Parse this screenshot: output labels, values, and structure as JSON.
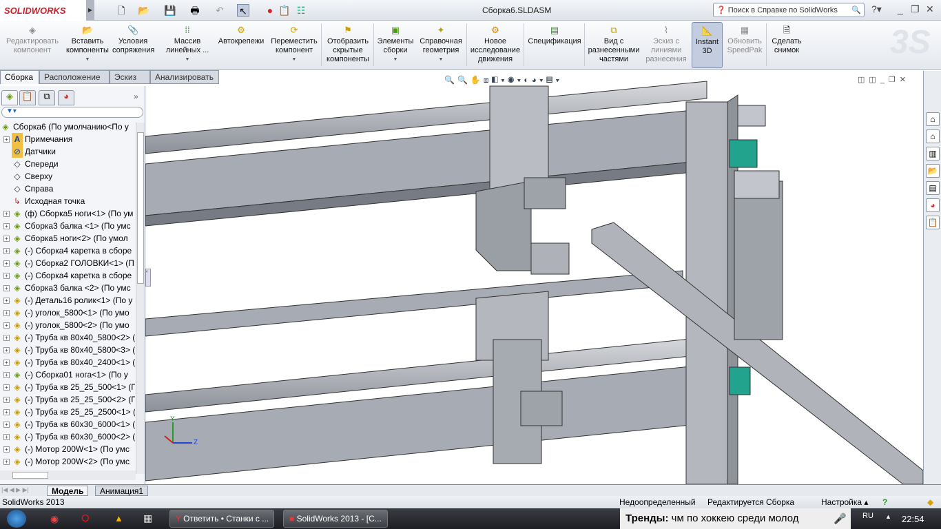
{
  "app": {
    "logo": "SOLIDWORKS",
    "title": "Сборка6.SLDASM",
    "search_placeholder": "Поиск в Справке по SolidWorks"
  },
  "quick_toolbar": [
    "new-icon",
    "open-icon",
    "save-icon",
    "print-icon",
    "undo-icon",
    "select-icon",
    "rebuild-icon",
    "file-properties-icon",
    "options-icon"
  ],
  "command_manager": [
    {
      "label": "Редактировать компонент",
      "disabled": true,
      "icon": "edit-component-icon"
    },
    {
      "label": "Вставить компоненты",
      "dropdown": true,
      "icon": "insert-components-icon"
    },
    {
      "label": "Условия сопряжения",
      "icon": "mate-icon"
    },
    {
      "label": "Массив линейных ...",
      "dropdown": true,
      "icon": "linear-pattern-icon"
    },
    {
      "label": "Автокрепежи",
      "icon": "smart-fasteners-icon"
    },
    {
      "label": "Переместить компонент",
      "dropdown": true,
      "icon": "move-component-icon"
    },
    {
      "label": "Отобразить скрытые компоненты",
      "icon": "show-hidden-icon"
    },
    {
      "label": "Элементы сборки",
      "dropdown": true,
      "icon": "assembly-features-icon"
    },
    {
      "label": "Справочная геометрия",
      "dropdown": true,
      "icon": "reference-geometry-icon"
    },
    {
      "label": "Новое исследование движения",
      "icon": "motion-study-icon"
    },
    {
      "label": "Спецификация",
      "icon": "bom-icon"
    },
    {
      "label": "Вид с разнесенными частями",
      "icon": "exploded-view-icon"
    },
    {
      "label": "Эскиз с линиями разнесения",
      "disabled": true,
      "icon": "explode-line-sketch-icon"
    },
    {
      "label": "Instant 3D",
      "active": true,
      "icon": "instant3d-icon"
    },
    {
      "label": "Обновить SpeedPak",
      "disabled": true,
      "icon": "speedpak-icon"
    },
    {
      "label": "Сделать снимок",
      "icon": "snapshot-icon"
    }
  ],
  "tabs": [
    "Сборка",
    "Расположение",
    "Эскиз",
    "Анализировать"
  ],
  "tree": {
    "root": "Сборка6  (По умолчанию<По у",
    "items": [
      {
        "label": "Примечания",
        "icon": "annotations-icon",
        "expand": true
      },
      {
        "label": "Датчики",
        "icon": "sensors-icon"
      },
      {
        "label": "Спереди",
        "icon": "plane-icon"
      },
      {
        "label": "Сверху",
        "icon": "plane-icon"
      },
      {
        "label": "Справа",
        "icon": "plane-icon"
      },
      {
        "label": "Исходная точка",
        "icon": "origin-icon"
      },
      {
        "label": "(ф) Сборка5 ноги<1> (По ум",
        "icon": "assembly",
        "expand": true
      },
      {
        "label": "Сборка3 балка <1> (По умс",
        "icon": "assembly",
        "expand": true
      },
      {
        "label": "Сборка5 ноги<2> (По умол",
        "icon": "assembly",
        "expand": true
      },
      {
        "label": "(-) Сборка4 каретка в сборе",
        "icon": "assembly",
        "expand": true
      },
      {
        "label": "(-) Сборка2 ГОЛОВКИ<1> (П",
        "icon": "assembly",
        "expand": true
      },
      {
        "label": "(-) Сборка4 каретка в сборе",
        "icon": "assembly",
        "expand": true
      },
      {
        "label": "Сборка3 балка <2> (По умс",
        "icon": "assembly",
        "expand": true
      },
      {
        "label": "(-) Деталь16 ролик<1> (По у",
        "icon": "part",
        "expand": true
      },
      {
        "label": "(-) уголок_5800<1> (По умо",
        "icon": "part",
        "expand": true
      },
      {
        "label": "(-) уголок_5800<2> (По умо",
        "icon": "part",
        "expand": true
      },
      {
        "label": "(-) Труба кв 80х40_5800<2> (",
        "icon": "part",
        "expand": true
      },
      {
        "label": "(-) Труба кв 80х40_5800<3> (",
        "icon": "part",
        "expand": true
      },
      {
        "label": "(-) Труба кв 80х40_2400<1> (",
        "icon": "part",
        "expand": true
      },
      {
        "label": "(-) Сборка01 нога<1> (По у",
        "icon": "assembly",
        "expand": true
      },
      {
        "label": "(-) Труба кв 25_25_500<1> (П",
        "icon": "part",
        "expand": true
      },
      {
        "label": "(-) Труба кв 25_25_500<2> (П",
        "icon": "part",
        "expand": true
      },
      {
        "label": "(-) Труба кв 25_25_2500<1> (",
        "icon": "part",
        "expand": true
      },
      {
        "label": "(-) Труба кв 60х30_6000<1> (",
        "icon": "part",
        "expand": true
      },
      {
        "label": "(-) Труба кв 60х30_6000<2> (",
        "icon": "part",
        "expand": true
      },
      {
        "label": "(-) Мотор 200W<1> (По умс",
        "icon": "part",
        "expand": true
      },
      {
        "label": "(-) Мотор 200W<2> (По умс",
        "icon": "part",
        "expand": true
      }
    ]
  },
  "bottom_tabs": [
    "Модель",
    "Анимация1"
  ],
  "status": {
    "app": "SolidWorks 2013",
    "state": "Недоопределенный",
    "editing": "Редактируется Сборка",
    "custom": "Настройка"
  },
  "taskbar": {
    "windows": [
      "Ответить • Станки с ...",
      "SolidWorks 2013 - [С..."
    ],
    "trends_label": "Тренды:",
    "trends_text": "чм по хоккею среди молод",
    "lang": "RU",
    "time": "22:54"
  },
  "colors": {
    "logo": "#d1202a",
    "viewport_bg": "#ffffff",
    "steel": "#a9acb4"
  }
}
